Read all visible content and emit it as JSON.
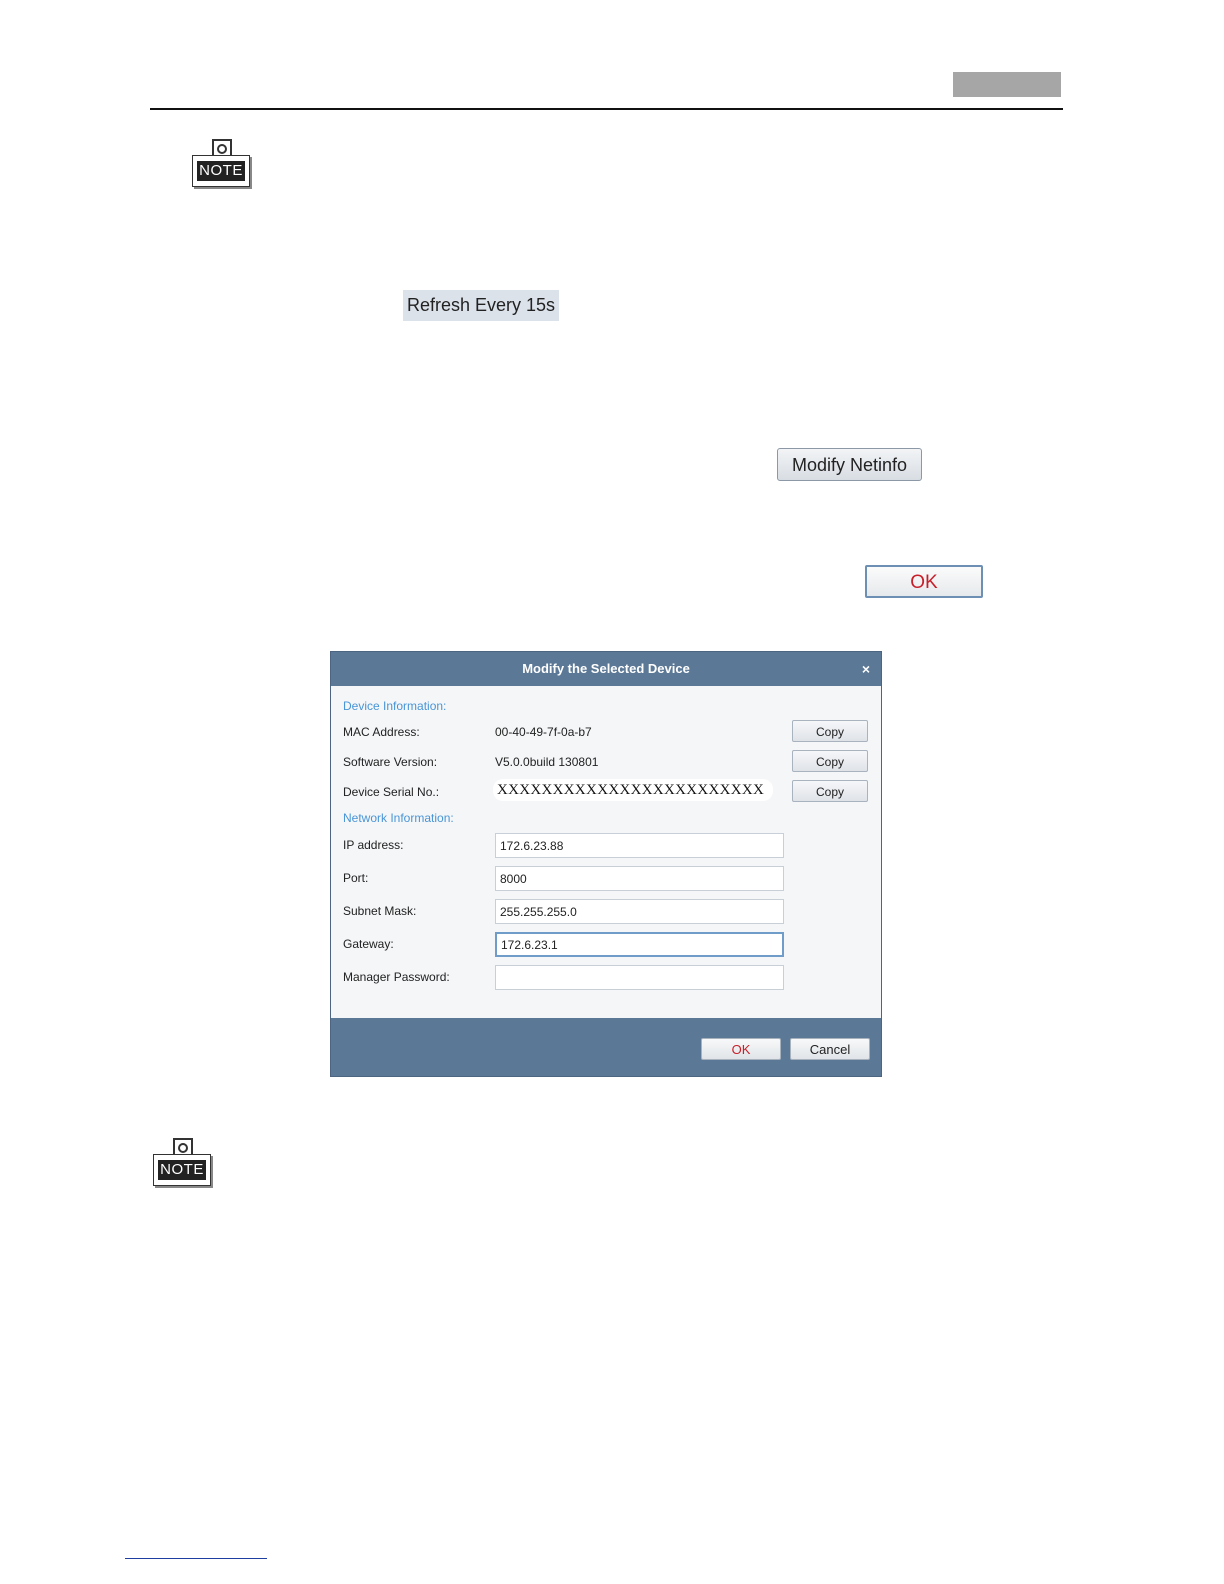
{
  "note_icon_label": "NOTE",
  "buttons": {
    "refresh": "Refresh Every 15s",
    "modify_netinfo": "Modify Netinfo",
    "ok": "OK"
  },
  "dialog": {
    "title": "Modify the Selected Device",
    "close_glyph": "×",
    "device_section_title": "Device Information:",
    "network_section_title": "Network Information:",
    "mac_label": "MAC Address:",
    "mac_value": "00-40-49-7f-0a-b7",
    "software_label": "Software Version:",
    "software_value": "V5.0.0build 130801",
    "serial_label": "Device Serial No.:",
    "serial_value": "XXXXXXXXXXXXXXXXXXXXXXXX",
    "copy_label": "Copy",
    "ip_label": "IP address:",
    "ip_value": "172.6.23.88",
    "port_label": "Port:",
    "port_value": "8000",
    "mask_label": "Subnet Mask:",
    "mask_value": "255.255.255.0",
    "gateway_label": "Gateway:",
    "gateway_value": "172.6.23.1",
    "password_label": "Manager Password:",
    "password_value": "",
    "ok_label": "OK",
    "cancel_label": "Cancel"
  },
  "colors": {
    "dialog_header": "#5b7896",
    "section_title": "#4a95d6",
    "ok_text": "#c8202a"
  }
}
